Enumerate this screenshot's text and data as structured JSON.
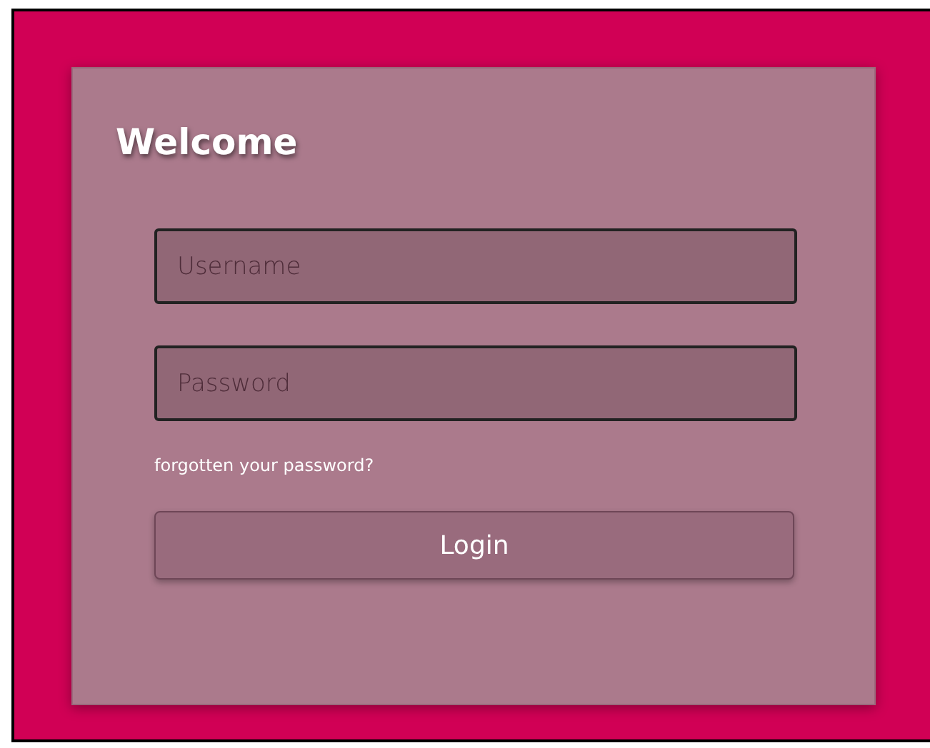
{
  "title": "Welcome",
  "fields": [
    {
      "placeholder": "Username"
    },
    {
      "placeholder": "Password"
    }
  ],
  "link": "forgotten your password?",
  "button": "Login"
}
